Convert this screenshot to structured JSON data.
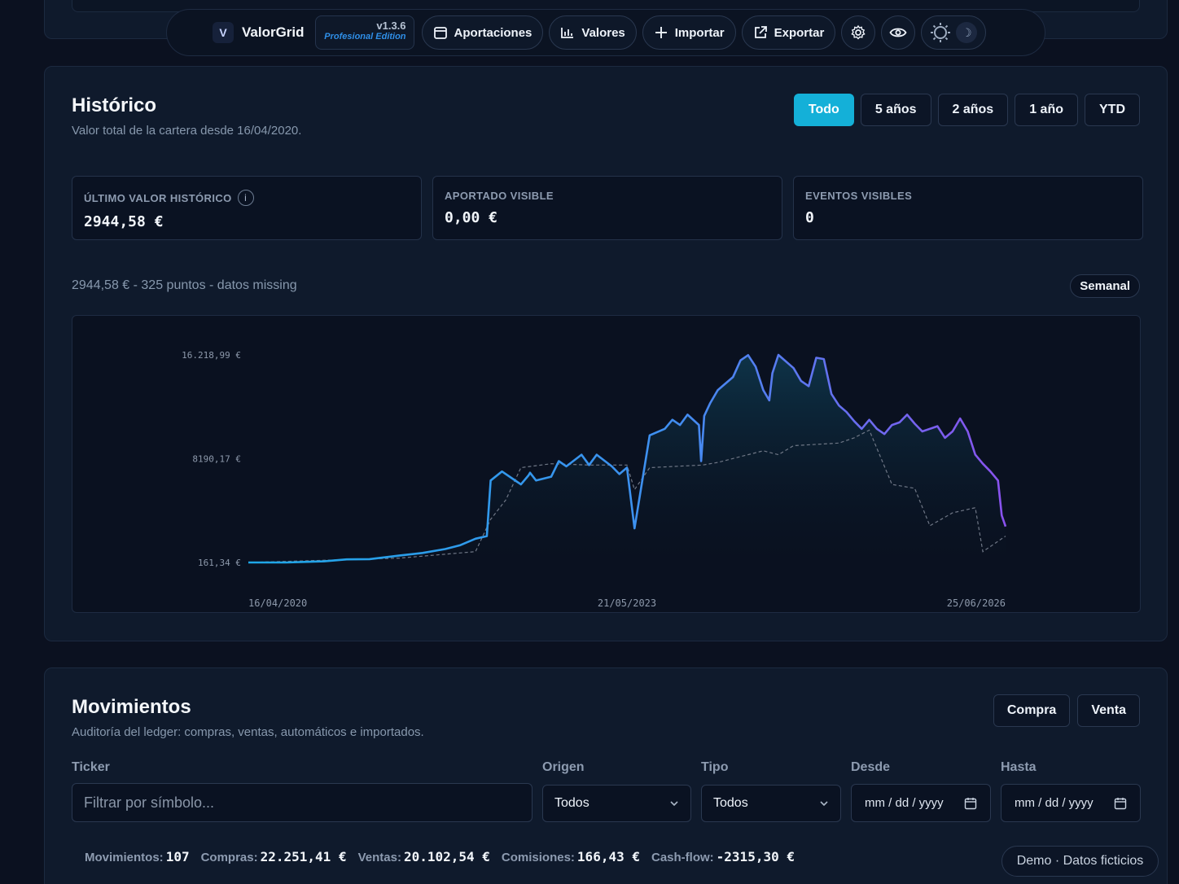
{
  "toolbar": {
    "logo_letter": "V",
    "brand": "ValorGrid",
    "version": "v1.3.6",
    "edition": "Profesional Edition",
    "buttons": {
      "aportaciones": "Aportaciones",
      "valores": "Valores",
      "importar": "Importar",
      "exportar": "Exportar"
    },
    "icons": [
      "calendar-icon",
      "bar-chart-icon",
      "plus-icon",
      "external-link-icon",
      "gear-icon",
      "eye-icon",
      "sun-icon",
      "moon-icon"
    ],
    "moon_glyph": "☽"
  },
  "historico": {
    "title": "Histórico",
    "subtitle": "Valor total de la cartera desde 16/04/2020.",
    "ranges": [
      "Todo",
      "5 años",
      "2 años",
      "1 año",
      "YTD"
    ],
    "active_range": "Todo",
    "stats": [
      {
        "label": "ÚLTIMO VALOR HISTÓRICO",
        "value": "2944,58 €",
        "has_info": true
      },
      {
        "label": "APORTADO VISIBLE",
        "value": "0,00 €"
      },
      {
        "label": "EVENTOS VISIBLES",
        "value": "0"
      }
    ],
    "info_glyph": "i",
    "meta": "2944,58 € - 325 puntos - datos missing",
    "frequency": "Semanal"
  },
  "chart_data": {
    "type": "line",
    "title": "",
    "xlabel": "",
    "ylabel": "",
    "y_ticks": [
      "16.218,99 €",
      "8190,17 €",
      "161,34 €"
    ],
    "x_ticks": [
      "16/04/2020",
      "21/05/2023",
      "25/06/2026"
    ],
    "ylim": [
      161.34,
      16218.99
    ],
    "xlim": [
      "2020-04-16",
      "2026-06-25"
    ],
    "grid": false,
    "legend": "none",
    "colors": {
      "start": "#1ea7e6",
      "end": "#8a52ee",
      "dashed": "#6f7786"
    },
    "series": [
      {
        "style": "solid",
        "x": [
          0.0,
          0.05,
          0.1,
          0.13,
          0.16,
          0.2,
          0.23,
          0.26,
          0.28,
          0.3,
          0.315,
          0.32,
          0.335,
          0.36,
          0.37,
          0.372,
          0.38,
          0.4,
          0.41,
          0.42,
          0.44,
          0.45,
          0.46,
          0.48,
          0.49,
          0.5,
          0.51,
          0.53,
          0.55,
          0.56,
          0.57,
          0.58,
          0.595,
          0.598,
          0.602,
          0.61,
          0.62,
          0.64,
          0.65,
          0.66,
          0.67,
          0.68,
          0.688,
          0.692,
          0.7,
          0.72,
          0.73,
          0.74,
          0.75,
          0.76,
          0.77,
          0.78,
          0.79,
          0.8,
          0.81,
          0.82,
          0.83,
          0.84,
          0.85,
          0.86,
          0.87,
          0.88,
          0.89,
          0.9,
          0.91,
          0.92,
          0.93,
          0.94,
          0.95,
          0.96,
          0.97,
          0.98,
          0.99,
          0.995,
          1.0
        ],
        "y": [
          161,
          161,
          250,
          400,
          420,
          700,
          900,
          1200,
          1500,
          2000,
          2200,
          6500,
          7200,
          6200,
          6900,
          7100,
          6500,
          6800,
          8000,
          7600,
          8500,
          7700,
          8500,
          7600,
          7000,
          7500,
          2800,
          10000,
          10500,
          11200,
          10800,
          11600,
          10800,
          8000,
          11500,
          12500,
          13500,
          14500,
          15800,
          16200,
          15300,
          13500,
          12700,
          14800,
          16218,
          15200,
          14200,
          13800,
          16000,
          15900,
          13200,
          12300,
          11800,
          11100,
          10500,
          11200,
          10500,
          10100,
          10800,
          11000,
          11600,
          10900,
          10300,
          10500,
          10700,
          9800,
          10300,
          11300,
          10300,
          8500,
          7800,
          7200,
          6500,
          3800,
          2944.58
        ]
      },
      {
        "style": "dashed",
        "x": [
          0.0,
          0.2,
          0.3,
          0.32,
          0.34,
          0.36,
          0.4,
          0.45,
          0.5,
          0.51,
          0.53,
          0.6,
          0.62,
          0.68,
          0.7,
          0.72,
          0.78,
          0.8,
          0.82,
          0.85,
          0.88,
          0.9,
          0.93,
          0.96,
          0.97,
          1.0
        ],
        "y": [
          161,
          500,
          1000,
          3500,
          5000,
          7500,
          7800,
          7700,
          7700,
          5800,
          7500,
          7700,
          7900,
          8800,
          8500,
          9200,
          9400,
          9800,
          10400,
          6200,
          5900,
          3000,
          4000,
          4400,
          1000,
          2200
        ]
      }
    ]
  },
  "movimientos": {
    "title": "Movimientos",
    "subtitle": "Auditoría del ledger: compras, ventas, automáticos e importados.",
    "actions": {
      "compra": "Compra",
      "venta": "Venta"
    },
    "filters": {
      "ticker_label": "Ticker",
      "ticker_placeholder": "Filtrar por símbolo...",
      "origen_label": "Origen",
      "origen_value": "Todos",
      "tipo_label": "Tipo",
      "tipo_value": "Todos",
      "desde_label": "Desde",
      "desde_value": "mm / dd / yyyy",
      "hasta_label": "Hasta",
      "hasta_value": "mm / dd / yyyy"
    },
    "summary": [
      {
        "label": "Movimientos:",
        "value": "107"
      },
      {
        "label": "Compras:",
        "value": "22.251,41 €"
      },
      {
        "label": "Ventas:",
        "value": "20.102,54 €"
      },
      {
        "label": "Comisiones:",
        "value": "166,43 €"
      },
      {
        "label": "Cash-flow:",
        "value": "-2315,30 €"
      }
    ]
  },
  "badge": "Demo · Datos ficticios"
}
